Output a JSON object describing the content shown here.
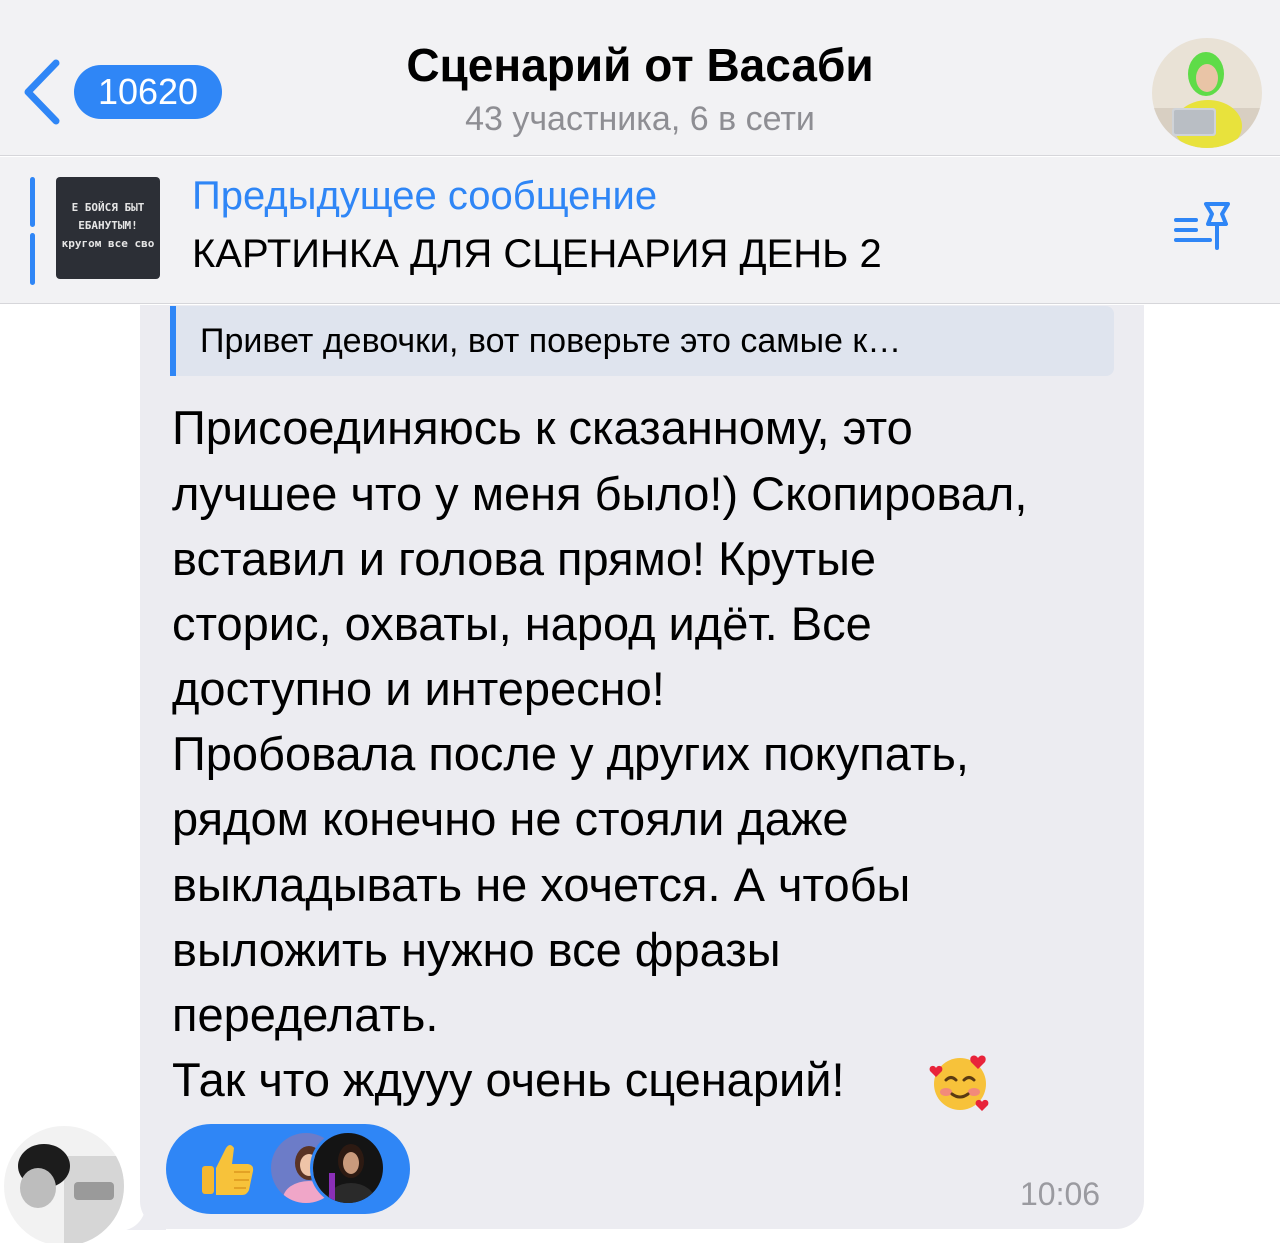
{
  "header": {
    "back_count": "10620",
    "title": "Сценарий от Васаби",
    "subtitle": "43 участника, 6 в сети",
    "accent": "#2f86f6"
  },
  "pinned": {
    "label": "Предыдущее сообщение",
    "text": "КАРТИНКА ДЛЯ СЦЕНАРИЯ ДЕНЬ 2",
    "thumb_lines": [
      "Е БОЙСЯ БЫТ",
      "ЕБАНУТЫМ!",
      "кругом все сво"
    ],
    "icon": "pinned-list-icon"
  },
  "message": {
    "reply_text": "Привет девочки, вот поверьте это самые к…",
    "lines": [
      "Присоединяюсь к сказанному, это",
      "лучшее что у меня было!) Скопировал,",
      "вставил и голова прямо! Крутые",
      "сторис, охваты, народ идёт.  Все",
      "доступно и интересно!",
      "Пробовала после у других покупать,",
      "рядом конечно не стояли даже",
      "выкладывать не хочется. А чтобы",
      "выложить нужно все фразы",
      "переделать.",
      "Так что ждууу очень  сценарий!"
    ],
    "emoji": "smiling-face-with-hearts",
    "time": "10:06",
    "reaction": "thumbs-up"
  }
}
